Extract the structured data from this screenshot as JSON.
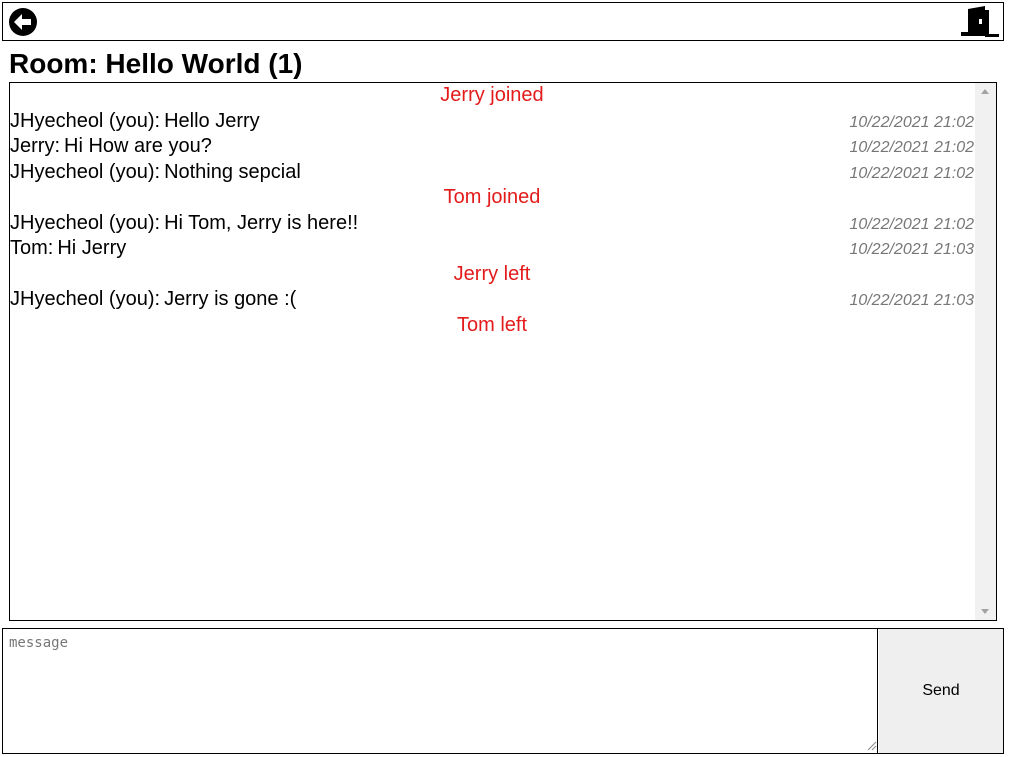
{
  "icons": {
    "back": "back-arrow-circle-icon",
    "exit": "exit-door-icon"
  },
  "room": {
    "title": "Room: Hello World (1)"
  },
  "colors": {
    "event_text": "#e31b1b",
    "timestamp_text": "#777777",
    "send_button_bg": "#efefef"
  },
  "messages": [
    {
      "type": "event",
      "text": "Jerry joined"
    },
    {
      "type": "chat",
      "sender": "JHyecheol (you):",
      "text": "Hello Jerry",
      "time": "10/22/2021 21:02"
    },
    {
      "type": "chat",
      "sender": "Jerry:",
      "text": "Hi How are you?",
      "time": "10/22/2021 21:02"
    },
    {
      "type": "chat",
      "sender": "JHyecheol (you):",
      "text": "Nothing sepcial",
      "time": "10/22/2021 21:02"
    },
    {
      "type": "event",
      "text": "Tom joined"
    },
    {
      "type": "chat",
      "sender": "JHyecheol (you):",
      "text": "Hi Tom, Jerry is here!!",
      "time": "10/22/2021 21:02"
    },
    {
      "type": "chat",
      "sender": "Tom:",
      "text": "Hi Jerry",
      "time": "10/22/2021 21:03"
    },
    {
      "type": "event",
      "text": "Jerry left"
    },
    {
      "type": "chat",
      "sender": "JHyecheol (you):",
      "text": "Jerry is gone :(",
      "time": "10/22/2021 21:03"
    },
    {
      "type": "event",
      "text": "Tom left"
    }
  ],
  "composer": {
    "placeholder": "message",
    "value": "",
    "send_label": "Send"
  }
}
